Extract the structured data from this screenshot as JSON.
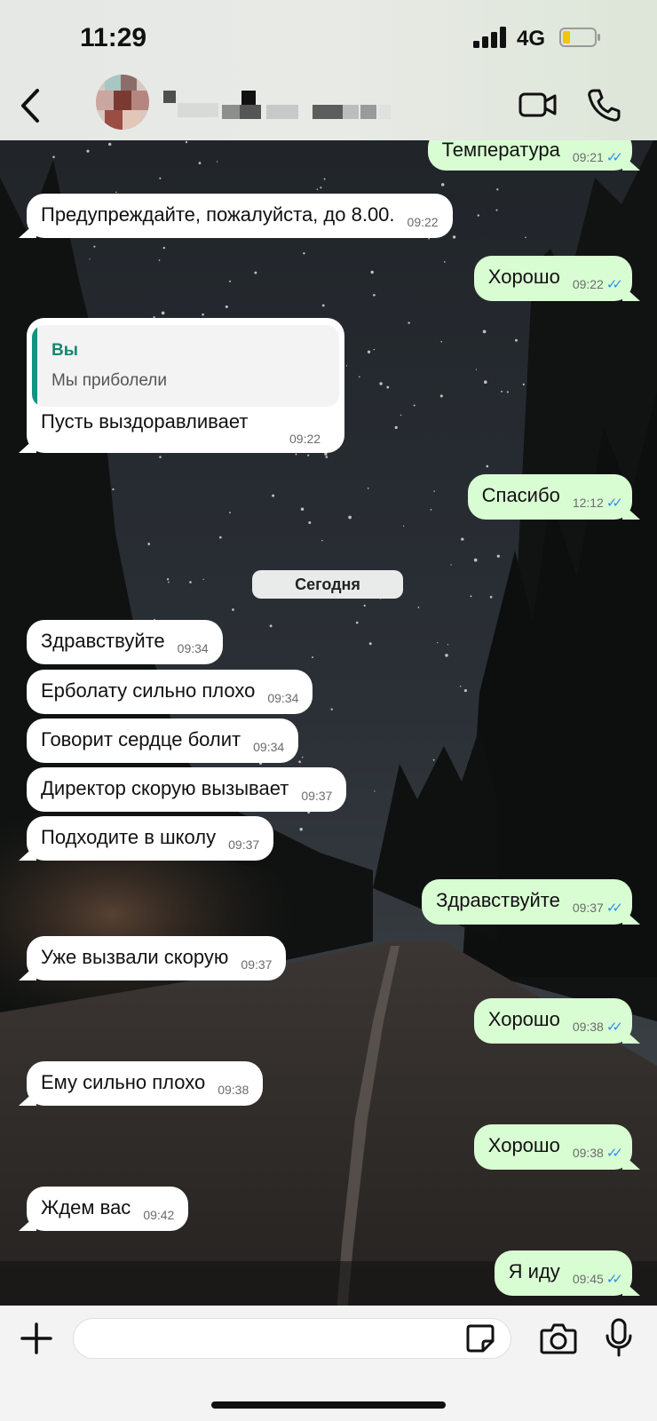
{
  "status_bar": {
    "time": "11:29",
    "network": "4G"
  },
  "header": {
    "contact_name": ""
  },
  "date_divider": "Сегодня",
  "reply": {
    "quoted_author": "Вы",
    "quoted_text": "Мы приболели",
    "text": "Пусть выздоравливает",
    "time": "09:22"
  },
  "messages": [
    {
      "dir": "out",
      "text": "Температура",
      "time": "09:21",
      "read": "✓✓"
    },
    {
      "dir": "in",
      "text": "Предупреждайте, пожалуйста, до 8.00.",
      "time": "09:22"
    },
    {
      "dir": "out",
      "text": "Хорошо",
      "time": "09:22",
      "read": "✓✓"
    },
    {
      "dir": "out",
      "text": "Спасибо",
      "time": "12:12",
      "read": "✓✓"
    },
    {
      "dir": "in",
      "text": "Здравствуйте",
      "time": "09:34"
    },
    {
      "dir": "in",
      "text": "Ерболату сильно плохо",
      "time": "09:34"
    },
    {
      "dir": "in",
      "text": "Говорит сердце болит",
      "time": "09:34"
    },
    {
      "dir": "in",
      "text": "Директор скорую вызывает",
      "time": "09:37"
    },
    {
      "dir": "in",
      "text": "Подходите в школу",
      "time": "09:37"
    },
    {
      "dir": "out",
      "text": "Здравствуйте",
      "time": "09:37",
      "read": "✓✓"
    },
    {
      "dir": "in",
      "text": "Уже вызвали скорую",
      "time": "09:37"
    },
    {
      "dir": "out",
      "text": "Хорошо",
      "time": "09:38",
      "read": "✓✓"
    },
    {
      "dir": "in",
      "text": "Ему сильно плохо",
      "time": "09:38"
    },
    {
      "dir": "out",
      "text": "Хорошо",
      "time": "09:38",
      "read": "✓✓"
    },
    {
      "dir": "in",
      "text": "Ждем вас",
      "time": "09:42"
    },
    {
      "dir": "out",
      "text": "Я иду",
      "time": "09:45",
      "read": "✓✓"
    }
  ],
  "input": {
    "placeholder": ""
  },
  "icons": {
    "back": "chevron-left-icon",
    "video": "video-camera-icon",
    "call": "phone-icon",
    "attach": "plus-icon",
    "sticker": "sticker-icon",
    "camera": "camera-icon",
    "mic": "microphone-icon"
  },
  "colors": {
    "incoming_bubble": "#ffffff",
    "outgoing_bubble": "#d9fdd3",
    "read_ticks": "#2f8fe8",
    "quote_accent": "#139482"
  }
}
